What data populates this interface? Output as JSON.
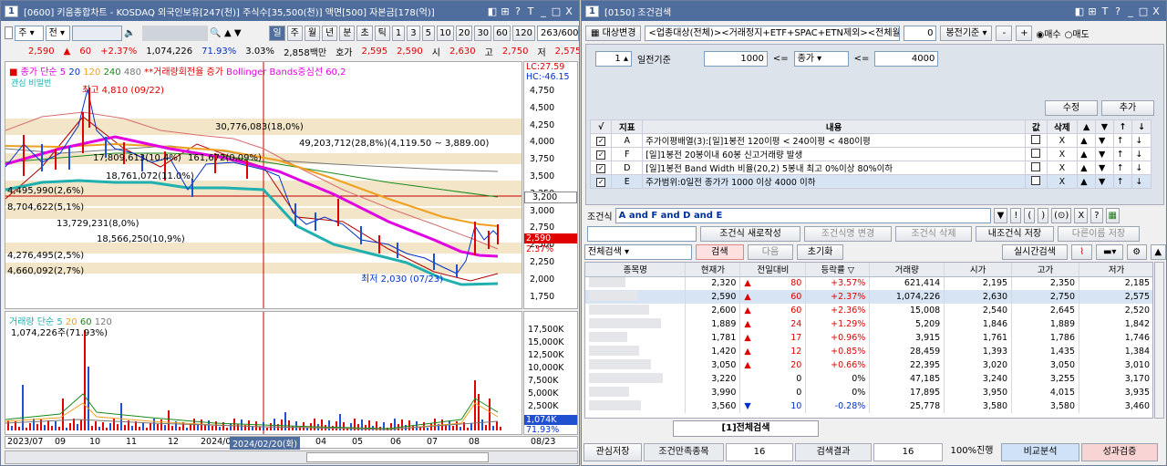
{
  "chart_window": {
    "title_num": "1",
    "title": "[0600] 키움종합차트 - KOSDAQ 외국인보유[247(천)] 주식수[35,500(천)] 액면[500] 자본금[178(억)]",
    "title_buttons": [
      "◧",
      "⊞",
      "?",
      "T",
      "_",
      "□",
      "X"
    ],
    "toolbar": {
      "type_sel": "주",
      "period_sel": "전",
      "period_buttons": [
        "일",
        "주",
        "월",
        "년",
        "분",
        "초",
        "틱"
      ],
      "num_buttons": [
        "1",
        "3",
        "5",
        "10",
        "20",
        "30",
        "60",
        "120"
      ],
      "counter": "263/600"
    },
    "price_row": {
      "price": "2,590",
      "change": "60",
      "change_pct": "+2.37%",
      "volume": "1,074,226",
      "vol_pct": "71.93%",
      "turnover": "3.03%",
      "amount": "2,858백만",
      "ask_label": "호가",
      "ask1": "2,595",
      "ask2": "2,590",
      "open_label": "시",
      "open": "2,630",
      "high_label": "고",
      "high": "2,750",
      "low_label": "저",
      "low": "2,575"
    },
    "legend": {
      "ma_label": "종가 단순 5",
      "ma20": "20",
      "ma120": "120",
      "ma240": "240",
      "ma480": "480",
      "turnover_label": "**거래량회전율 증가",
      "bb_label": "Bollinger Bands중심선 60,2",
      "lc": "LC:27.59",
      "hc": "HC:-46.15",
      "sub_label": "관심 비밀번"
    },
    "price_axis": [
      "4,750",
      "4,500",
      "4,250",
      "4,000",
      "3,750",
      "3,500",
      "3,250",
      "3,000",
      "2,750",
      "2,500",
      "2,250",
      "2,000",
      "1,750"
    ],
    "current_tag": "2,590",
    "current_pct": "2.37%",
    "target_tag": "3,200",
    "annotations": {
      "high": "최고 4,810 (09/22)",
      "low": "최저 2,030 (07/23)",
      "a1": "30,776,083(18,0%)",
      "a2": "49,203,712(28,8%)(4,119.50 ~ 3,889.00)",
      "a3": "17,809,613(10.4%)",
      "a4": "161,672(0,09%)",
      "a5": "18,761,072(11.0%)",
      "a6": "4,495,990(2,6%)",
      "a7": "8,704,622(5,1%)",
      "a8": "13,729,231(8,0%)",
      "a9": "18,566,250(10,9%)",
      "a10": "4,276,495(2,5%)",
      "a11": "4,660,092(2,7%)"
    },
    "volume_legend": {
      "label": "거래량 단순 5",
      "ma20": "20",
      "ma60": "60",
      "ma120": "120",
      "value": "1,074,226주(71.93%)"
    },
    "volume_axis": [
      "17,500K",
      "15,000K",
      "12,500K",
      "10,000K",
      "7,500K",
      "5,000K",
      "2,500K"
    ],
    "volume_tag": "1,074K",
    "volume_pct": "71.93%",
    "x_axis": [
      "2023/07",
      "09",
      "10",
      "11",
      "12",
      "2024/0",
      "04",
      "05",
      "06",
      "07",
      "08",
      "08/23"
    ],
    "crosshair_date": "2024/02/20(화)"
  },
  "cond_window": {
    "title_num": "1",
    "title": "[0150] 조건검색",
    "title_buttons": [
      "◧",
      "⊞",
      "T",
      "?",
      "_",
      "□",
      "X"
    ],
    "target_button": "대상변경",
    "target_text": "<업종대상(전체)><거래정지+ETF+SPAC+ETN제외><전체월결산>",
    "target_num": "0",
    "bong_button": "봉전기준",
    "minus_button": "-",
    "plus_button": "+",
    "radio_buy": "매수",
    "radio_sell": "매도",
    "days_value": "1",
    "days_label": "일전기준",
    "min_value": "1000",
    "le1": "<=",
    "field_sel": "종가",
    "le2": "<=",
    "max_value": "4000",
    "edit_button": "수정",
    "add_button": "추가",
    "cond_headers": [
      "√",
      "지표",
      "내용",
      "값",
      "삭제",
      "▲",
      "▼",
      "↑",
      "↓"
    ],
    "conditions": [
      {
        "letter": "A",
        "content": "주가이평배열(3):[일]1봉전 120이평 < 240이평 < 480이평",
        "del": "X"
      },
      {
        "letter": "F",
        "content": "[일]1봉전 20봉이내 60봉 신고거래량 발생",
        "del": "X"
      },
      {
        "letter": "D",
        "content": "[일]1봉전 Band Width 비율(20,2) 5봉내 최고 0%이상 80%이하",
        "del": "X"
      },
      {
        "letter": "E",
        "content": "주가범위:0일전 종가가 1000 이상 4000 이하",
        "del": "X"
      }
    ],
    "formula_label": "조건식",
    "formula": "A and F and D and E",
    "formula_buttons": [
      "▼",
      "!",
      "(",
      ")",
      "(⊙)",
      "X",
      "?"
    ],
    "new_cond": "조건식 새로작성",
    "modify_cond": "조건식명 변경",
    "delete_cond": "조건식 삭제",
    "save_cond": "내조건식 저장",
    "save_other": "다른이름 저장",
    "search_scope": "전체검색",
    "search_btn": "검색",
    "next_btn": "다음",
    "reset_btn": "초기화",
    "realtime_btn": "실시간검색",
    "result_headers": [
      "종목명",
      "현재가",
      "전일대비",
      "등락률 ▽",
      "거래량",
      "시가",
      "고가",
      "저가"
    ],
    "results": [
      {
        "price": "2,320",
        "dir": "▲",
        "chg": "80",
        "pct": "+3.57%",
        "vol": "621,414",
        "open": "2,195",
        "high": "2,350",
        "low": "2,185"
      },
      {
        "price": "2,590",
        "dir": "▲",
        "chg": "60",
        "pct": "+2.37%",
        "vol": "1,074,226",
        "open": "2,630",
        "high": "2,750",
        "low": "2,575"
      },
      {
        "price": "2,600",
        "dir": "▲",
        "chg": "60",
        "pct": "+2.36%",
        "vol": "15,008",
        "open": "2,540",
        "high": "2,645",
        "low": "2,520"
      },
      {
        "price": "1,889",
        "dir": "▲",
        "chg": "24",
        "pct": "+1.29%",
        "vol": "5,209",
        "open": "1,846",
        "high": "1,889",
        "low": "1,842"
      },
      {
        "price": "1,781",
        "dir": "▲",
        "chg": "17",
        "pct": "+0.96%",
        "vol": "3,915",
        "open": "1,761",
        "high": "1,786",
        "low": "1,746"
      },
      {
        "price": "1,420",
        "dir": "▲",
        "chg": "12",
        "pct": "+0.85%",
        "vol": "28,459",
        "open": "1,393",
        "high": "1,435",
        "low": "1,384"
      },
      {
        "price": "3,050",
        "dir": "▲",
        "chg": "20",
        "pct": "+0.66%",
        "vol": "22,395",
        "open": "3,020",
        "high": "3,050",
        "low": "3,010"
      },
      {
        "price": "3,220",
        "dir": "",
        "chg": "0",
        "pct": "0%",
        "vol": "47,185",
        "open": "3,240",
        "high": "3,255",
        "low": "3,170"
      },
      {
        "price": "3,990",
        "dir": "",
        "chg": "0",
        "pct": "0%",
        "vol": "17,895",
        "open": "3,950",
        "high": "4,015",
        "low": "3,935"
      },
      {
        "price": "3,560",
        "dir": "▼",
        "chg": "10",
        "pct": "-0.28%",
        "vol": "25,778",
        "open": "3,580",
        "high": "3,580",
        "low": "3,460"
      }
    ],
    "result_tab": "[1]전체검색",
    "bottom": {
      "fav_save": "관심저장",
      "count_label": "조건만족종목",
      "count": "16",
      "result_label": "검색결과",
      "result_count": "16",
      "progress": "100%진행",
      "compare": "비교분석",
      "verify": "성과검증"
    }
  }
}
